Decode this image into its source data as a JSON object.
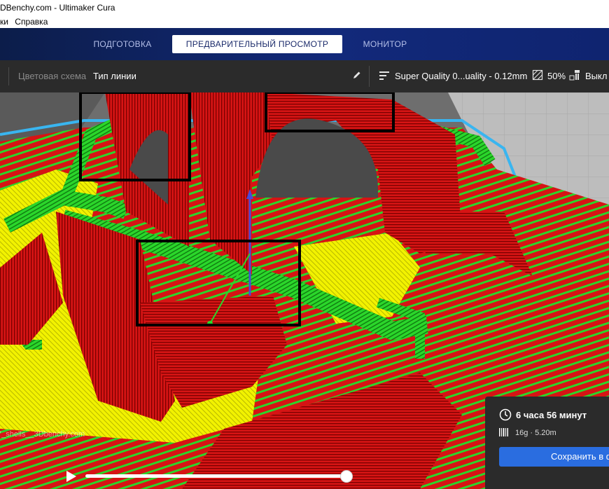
{
  "window": {
    "title": "DBenchy.com - Ultimaker Cura"
  },
  "menubar": {
    "items": [
      "ки",
      "Справка"
    ]
  },
  "stages": {
    "prepare": "ПОДГОТОВКА",
    "preview": "ПРЕДВАРИТЕЛЬНЫЙ ПРОСМОТР",
    "monitor": "МОНИТОР",
    "active": "preview"
  },
  "toolbar": {
    "color_scheme_label": "Цветовая схема",
    "color_scheme_value": "Тип линии",
    "profile": "Super Quality 0...uality - 0.12mm",
    "infill": "50%",
    "support": "Выкл"
  },
  "viewport": {
    "watermark": "7_shells__3Dbenchy.com",
    "line_colors": {
      "wall": "#e01b1b",
      "inner_wall": "#2bd62b",
      "skin": "#f5f500",
      "build_plate_outline": "#39b5f0"
    },
    "layer_progress": 1.0
  },
  "job": {
    "print_time": "6 часа 56 минут",
    "material": "16g · 5.20m",
    "save_label": "Сохранить в файл"
  },
  "colors": {
    "accent": "#2a6de0",
    "header": "#12297a",
    "toolbar": "#2b2b2b"
  }
}
